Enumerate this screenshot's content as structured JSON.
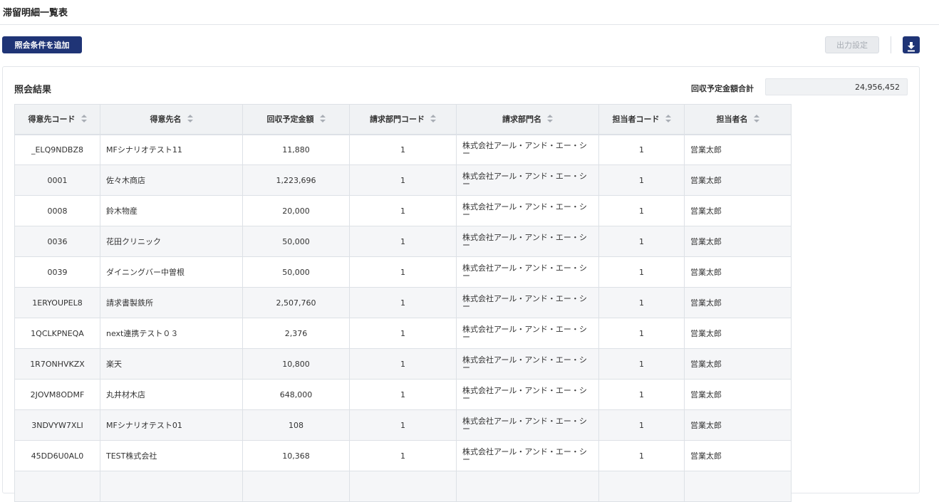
{
  "page": {
    "title": "滞留明細一覧表"
  },
  "toolbar": {
    "add_condition_label": "照会条件を追加",
    "output_settings_label": "出力設定",
    "download_icon": "download-icon"
  },
  "results": {
    "title": "照会結果",
    "total_label": "回収予定金額合計",
    "total_value": "24,956,452",
    "columns": [
      "得意先コード",
      "得意先名",
      "回収予定金額",
      "請求部門コード",
      "請求部門名",
      "担当者コード",
      "担当者名"
    ],
    "rows": [
      [
        "_ELQ9NDBZ8",
        "MFシナリオテスト11",
        "11,880",
        "1",
        "株式会社アール・アンド・エー・シー",
        "1",
        "営業太郎"
      ],
      [
        "0001",
        "佐々木商店",
        "1,223,696",
        "1",
        "株式会社アール・アンド・エー・シー",
        "1",
        "営業太郎"
      ],
      [
        "0008",
        "鈴木物産",
        "20,000",
        "1",
        "株式会社アール・アンド・エー・シー",
        "1",
        "営業太郎"
      ],
      [
        "0036",
        "花田クリニック",
        "50,000",
        "1",
        "株式会社アール・アンド・エー・シー",
        "1",
        "営業太郎"
      ],
      [
        "0039",
        "ダイニングバー中曽根",
        "50,000",
        "1",
        "株式会社アール・アンド・エー・シー",
        "1",
        "営業太郎"
      ],
      [
        "1ERYOUPEL8",
        "請求書製鉄所",
        "2,507,760",
        "1",
        "株式会社アール・アンド・エー・シー",
        "1",
        "営業太郎"
      ],
      [
        "1QCLKPNEQA",
        "next連携テスト０３",
        "2,376",
        "1",
        "株式会社アール・アンド・エー・シー",
        "1",
        "営業太郎"
      ],
      [
        "1R7ONHVKZX",
        "楽天",
        "10,800",
        "1",
        "株式会社アール・アンド・エー・シー",
        "1",
        "営業太郎"
      ],
      [
        "2JOVM8ODMF",
        "丸井材木店",
        "648,000",
        "1",
        "株式会社アール・アンド・エー・シー",
        "1",
        "営業太郎"
      ],
      [
        "3NDVYW7XLI",
        "MFシナリオテスト01",
        "108",
        "1",
        "株式会社アール・アンド・エー・シー",
        "1",
        "営業太郎"
      ],
      [
        "45DD6U0AL0",
        "TEST株式会社",
        "10,368",
        "1",
        "株式会社アール・アンド・エー・シー",
        "1",
        "営業太郎"
      ],
      [
        "",
        "",
        "",
        "",
        "",
        "",
        ""
      ]
    ]
  },
  "colors": {
    "primary": "#1f3476",
    "header_bg": "#f0f2f4",
    "border": "#dde1e6",
    "disabled_text": "#a8adb4"
  }
}
